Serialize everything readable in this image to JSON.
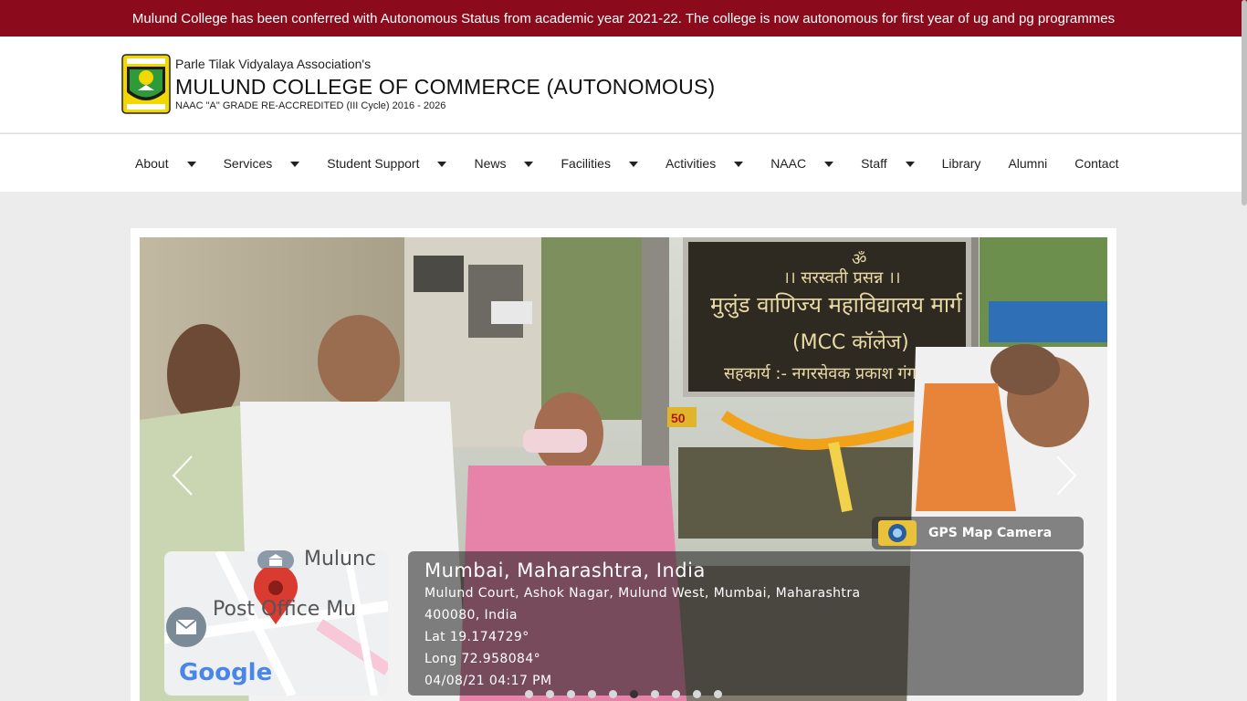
{
  "announcement": "Mulund College has been conferred with Autonomous Status from academic year 2021-22. The college is now autonomous for first year of ug and pg programmes",
  "header": {
    "association": "Parle Tilak Vidyalaya Association's",
    "college_name": "MULUND COLLEGE OF COMMERCE (AUTONOMOUS)",
    "accreditation": "NAAC \"A\" GRADE RE-ACCREDITED (III Cycle) 2016 - 2026"
  },
  "nav": {
    "items": [
      {
        "label": "About",
        "dropdown": true
      },
      {
        "label": "Services",
        "dropdown": true
      },
      {
        "label": "Student Support",
        "dropdown": true
      },
      {
        "label": "News",
        "dropdown": true
      },
      {
        "label": "Facilities",
        "dropdown": true
      },
      {
        "label": "Activities",
        "dropdown": true
      },
      {
        "label": "NAAC",
        "dropdown": true
      },
      {
        "label": "Staff",
        "dropdown": true
      },
      {
        "label": "Library",
        "dropdown": false
      },
      {
        "label": "Alumni",
        "dropdown": false
      },
      {
        "label": "Contact",
        "dropdown": false
      }
    ]
  },
  "slider": {
    "sign_lines": [
      "।। सरस्वती प्रसन्न ।।",
      "मुलुंड वाणिज्य महाविद्यालय मार्ग",
      "(MCC कॉलेज)",
      "सहकार्य :- नगरसेवक प्रकाश गंगाधरे"
    ],
    "sign_om": "ॐ",
    "shop_number": "50",
    "gps_label": "GPS Map Camera",
    "map_label_1": "Mulunc",
    "map_label_2": "Post Office Mu",
    "google_label": "Google",
    "location_title": "Mumbai, Maharashtra, India",
    "address_line_1": "Mulund Court, Ashok Nagar, Mulund West, Mumbai, Maharashtra",
    "address_line_2": "400080, India",
    "latitude": "Lat 19.174729°",
    "longitude": "Long 72.958084°",
    "timestamp": "04/08/21 04:17 PM",
    "slide_count": 10,
    "active_slide": 6
  },
  "colors": {
    "brand_maroon": "#8b0a1c",
    "dot_active": "#333333",
    "dot_inactive": "#d8d8d8"
  }
}
